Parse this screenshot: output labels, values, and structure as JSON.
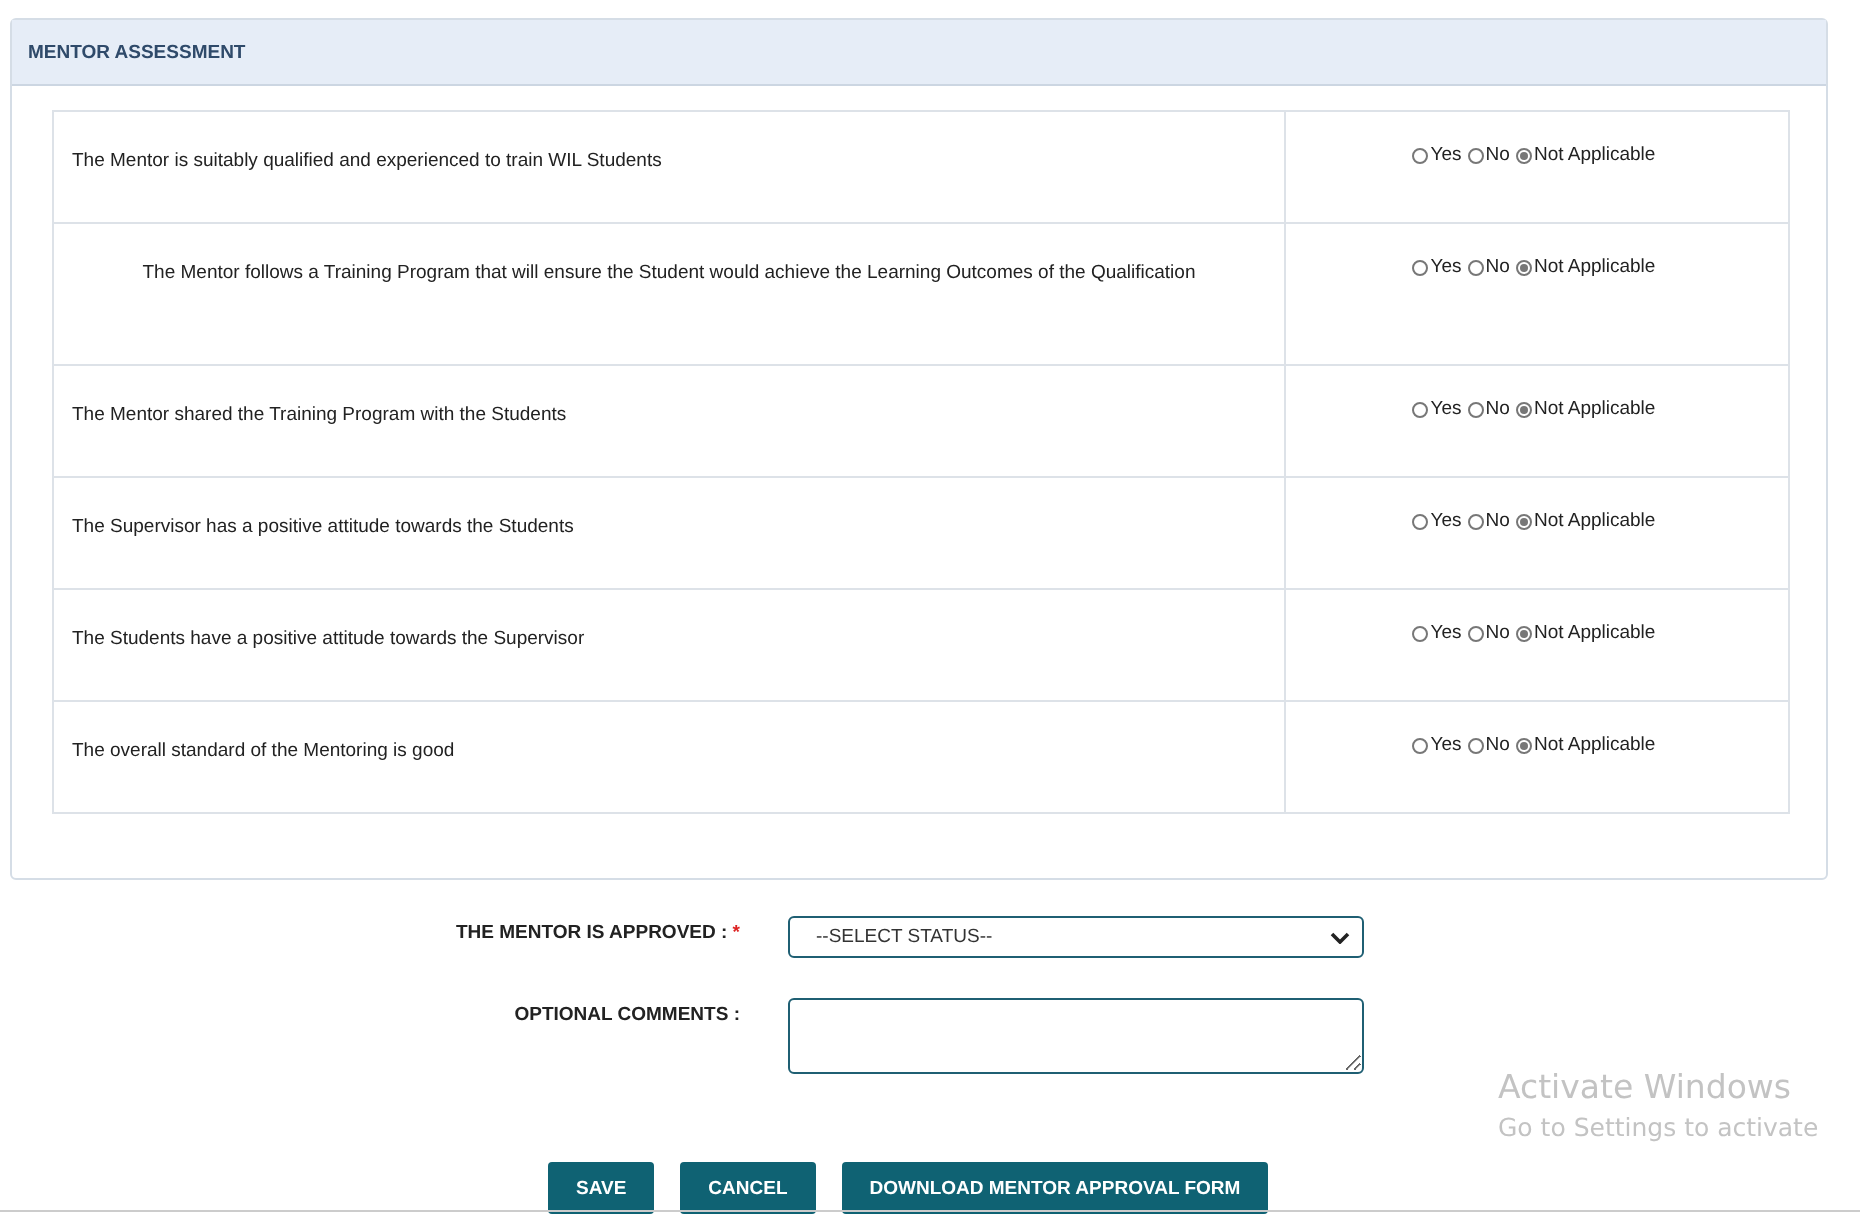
{
  "panel": {
    "title": "MENTOR ASSESSMENT"
  },
  "questions": [
    {
      "text": "The Mentor is suitably qualified and experienced to train WIL Students",
      "kind": "plain",
      "options": [
        {
          "label": "Yes",
          "selected": false
        },
        {
          "label": "No",
          "selected": false
        },
        {
          "label": "Not Applicable",
          "selected": true
        }
      ]
    },
    {
      "text": "The Mentor follows a Training Program that will ensure the Student would achieve the Learning Outcomes of the Qualification",
      "kind": "centered",
      "options": [
        {
          "label": "Yes",
          "selected": false
        },
        {
          "label": "No",
          "selected": false
        },
        {
          "label": "Not Applicable",
          "selected": true
        }
      ]
    },
    {
      "text": "The Mentor shared the Training Program with the Students",
      "kind": "plain",
      "options": [
        {
          "label": "Yes",
          "selected": false
        },
        {
          "label": "No",
          "selected": false
        },
        {
          "label": "Not Applicable",
          "selected": true
        }
      ]
    },
    {
      "text": "The Supervisor has a positive attitude towards the Students",
      "kind": "plain",
      "options": [
        {
          "label": "Yes",
          "selected": false
        },
        {
          "label": "No",
          "selected": false
        },
        {
          "label": "Not Applicable",
          "selected": true
        }
      ]
    },
    {
      "text": "The Students have a positive attitude towards the Supervisor",
      "kind": "plain",
      "options": [
        {
          "label": "Yes",
          "selected": false
        },
        {
          "label": "No",
          "selected": false
        },
        {
          "label": "Not Applicable",
          "selected": true
        }
      ]
    },
    {
      "text": "The overall standard of the Mentoring is good",
      "kind": "plain",
      "options": [
        {
          "label": "Yes",
          "selected": false
        },
        {
          "label": "No",
          "selected": false
        },
        {
          "label": "Not Applicable",
          "selected": true
        }
      ]
    }
  ],
  "approval": {
    "label": "THE MENTOR IS APPROVED :",
    "required_mark": "*",
    "value": "--SELECT STATUS--"
  },
  "comments": {
    "label": "OPTIONAL COMMENTS :"
  },
  "buttons": [
    "SAVE",
    "CANCEL",
    "DOWNLOAD MENTOR APPROVAL FORM"
  ],
  "os_notice": {
    "title": "Activate Windows",
    "text": "Go to Settings to activate"
  }
}
